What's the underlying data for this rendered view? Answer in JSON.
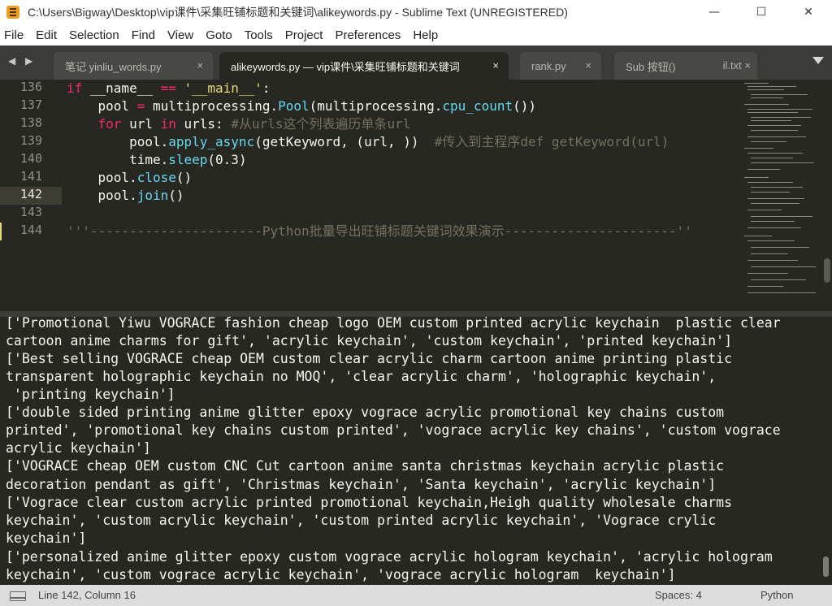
{
  "window": {
    "title": "C:\\Users\\Bigway\\Desktop\\vip课件\\采集旺铺标题和关键词\\alikeywords.py - Sublime Text (UNREGISTERED)",
    "minimize": "—",
    "maximize": "☐",
    "close": "✕"
  },
  "menu": [
    "File",
    "Edit",
    "Selection",
    "Find",
    "View",
    "Goto",
    "Tools",
    "Project",
    "Preferences",
    "Help"
  ],
  "tabs": [
    {
      "label": "笔记   yinliu_words.py",
      "close": "×"
    },
    {
      "label": "alikeywords.py — vip课件\\采集旺铺标题和关键词",
      "close": "×"
    },
    {
      "label": "rank.py",
      "close": "×"
    },
    {
      "label": "Sub 按钮() ",
      "close": "il.txt  ×"
    }
  ],
  "nav_arrows": "◀ ▶",
  "editor": {
    "line_numbers": [
      "136",
      "137",
      "138",
      "139",
      "140",
      "141",
      "142",
      "143",
      "144"
    ],
    "current_line": "142"
  },
  "output": [
    "['Promotional Yiwu VOGRACE fashion cheap logo OEM custom printed acrylic keychain  plastic clear",
    "cartoon anime charms for gift', 'acrylic keychain', 'custom keychain', 'printed keychain']",
    "['Best selling VOGRACE cheap OEM custom clear acrylic charm cartoon anime printing plastic",
    "transparent holographic keychain no MOQ', 'clear acrylic charm', 'holographic keychain',",
    " 'printing keychain']",
    "['double sided printing anime glitter epoxy vograce acrylic promotional key chains custom",
    "printed', 'promotional key chains custom printed', 'vograce acrylic key chains', 'custom vograce",
    "acrylic keychain']",
    "['VOGRACE cheap OEM custom CNC Cut cartoon anime santa christmas keychain acrylic plastic",
    "decoration pendant as gift', 'Christmas keychain', 'Santa keychain', 'acrylic keychain']",
    "['Vograce clear custom acrylic printed promotional keychain,Heigh quality wholesale charms",
    "keychain', 'custom acrylic keychain', 'custom printed acrylic keychain', 'Vograce crylic",
    "keychain']",
    "['personalized anime glitter epoxy custom vograce acrylic hologram keychain', 'acrylic hologram",
    "keychain', 'custom vograce acrylic keychain', 'vograce acrylic hologram  keychain']"
  ],
  "status": {
    "position": "Line 142, Column 16",
    "spaces": "Spaces: 4",
    "syntax": "Python"
  },
  "colors": {
    "editor_bg": "#272822",
    "keyword": "#f92672",
    "string": "#e6db74",
    "function": "#66d9ef",
    "comment": "#75715e"
  }
}
